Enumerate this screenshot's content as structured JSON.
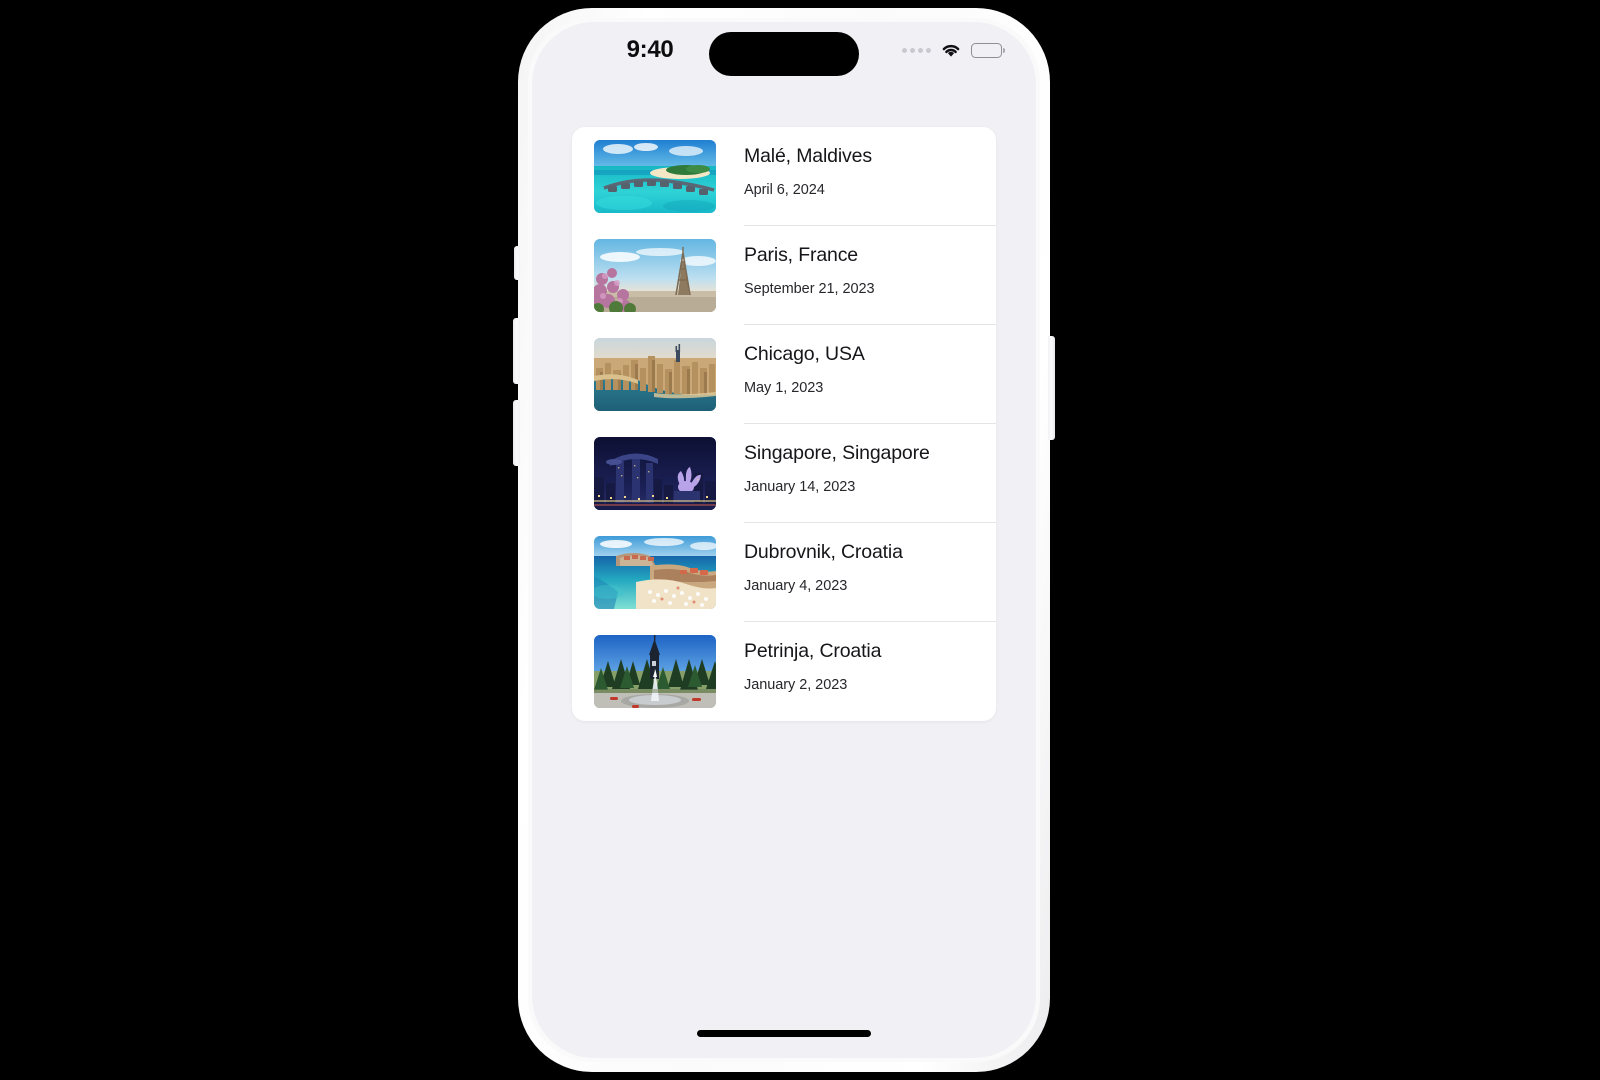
{
  "status_bar": {
    "time": "9:40",
    "cellular_icon": "cellular-dots-icon",
    "wifi_icon": "wifi-icon",
    "battery_icon": "battery-full-icon"
  },
  "list": {
    "items": [
      {
        "title": "Malé, Maldives",
        "date": "April 6, 2024",
        "thumbnail_name": "male-maldives-thumbnail"
      },
      {
        "title": "Paris, France",
        "date": "September 21, 2023",
        "thumbnail_name": "paris-france-thumbnail"
      },
      {
        "title": "Chicago, USA",
        "date": "May 1, 2023",
        "thumbnail_name": "chicago-usa-thumbnail"
      },
      {
        "title": "Singapore, Singapore",
        "date": "January 14, 2023",
        "thumbnail_name": "singapore-singapore-thumbnail"
      },
      {
        "title": "Dubrovnik, Croatia",
        "date": "January 4, 2023",
        "thumbnail_name": "dubrovnik-croatia-thumbnail"
      },
      {
        "title": "Petrinja, Croatia",
        "date": "January 2, 2023",
        "thumbnail_name": "petrinja-croatia-thumbnail"
      }
    ]
  },
  "colors": {
    "screen_background": "#f1f0f5",
    "card_background": "#ffffff",
    "title_text": "#16161a",
    "date_text": "#27272c",
    "divider": "#e4e4e8",
    "device_frame": "#fafafb"
  }
}
